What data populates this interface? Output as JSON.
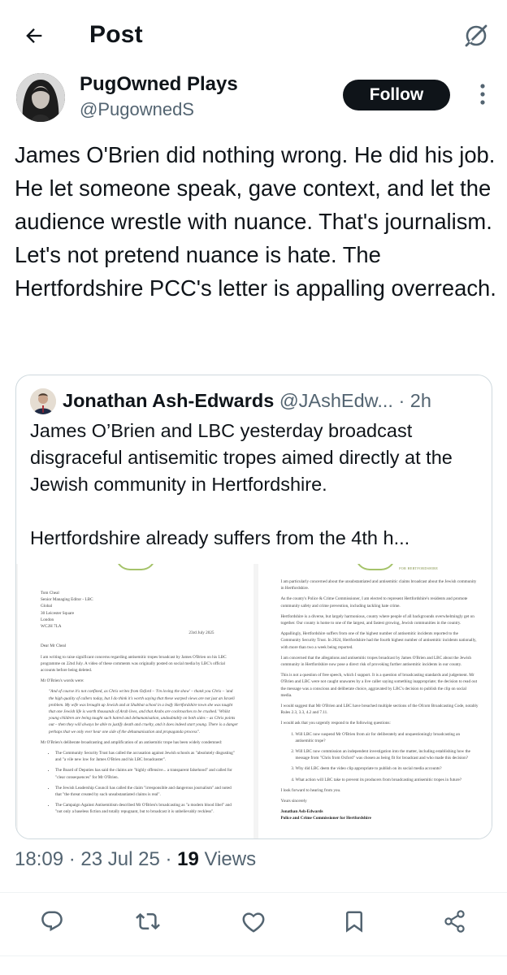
{
  "header": {
    "title": "Post"
  },
  "author": {
    "name": "PugOwned Plays",
    "handle": "@PugownedS",
    "follow_label": "Follow"
  },
  "post": {
    "text": "James O'Brien did nothing wrong. He did his job. He let someone speak, gave context, and let the audience wrestle with nuance. That's journalism. Let's not pretend nuance is hate. The Hertfordshire PCC's letter is appalling overreach."
  },
  "quote": {
    "name": "Jonathan Ash-Edwards",
    "handle": "@JAshEdw...",
    "time": "· 2h",
    "text_p1": "James O’Brien and LBC yesterday broadcast disgraceful antisemitic tropes aimed directly at the Jewish community in Hertfordshire.",
    "text_p2": "Hertfordshire already suffers from the 4th h..."
  },
  "letter_left": {
    "recipient": [
      "Tom Cheal",
      "Senior Managing Editor - LBC",
      "Global",
      "30 Leicester Square",
      "London",
      "WC2H 7LA"
    ],
    "date": "23rd July 2025",
    "salutation": "Dear Mr Cheal",
    "p1": "I am writing to raise significant concerns regarding antisemitic tropes broadcast by James O'Brien on his LBC programme on 22nd July. A video of these comments was originally posted on social media by LBC's official accounts before being deleted.",
    "p2": "Mr O'Brien's words were:",
    "quote": "\"And of course it's not confined, as Chris writes from Oxford – 'I'm loving the show' – thank you Chris – 'and the high quality of callers today, but I do think it's worth saying that these warped views are not just an Israeli problem. My wife was brought up Jewish and at Shabbat school in a leafy Hertfordshire town she was taught that one Jewish life is worth thousands of Arab lives, and that Arabs are cockroaches to be crushed.' Whilst young children are being taught such hatred and dehumanisation, undoubtably on both sides – as Chris points out – then they will always be able to justify death and cruelty, and it does indeed start young. There is a danger perhaps that we only ever hear one side of the dehumanisation and propaganda process\".",
    "p3": "Mr O'Brien's deliberate broadcasting and amplification of an antisemitic trope has been widely condemned:",
    "bullets": [
      "The Community Security Trust has called the accusation against Jewish schools as \"absolutely disgusting\" and \"a vile new low for James O'Brien and his LBC broadcaster\".",
      "The Board of Deputies has said the claims are \"highly offensive... a transparent falsehood\" and called for \"clear consequences\" for Mr O'Brien.",
      "The Jewish Leadership Council has called the claim \"irresponsible and dangerous journalism\" and noted that \"the threat created by such unsubstantiated claims is real\".",
      "The Campaign Against Antisemitism described Mr O'Brien's broadcasting as \"a modern blood libel\" and \"not only a baseless fiction and totally repugnant, but to broadcast it is unbelievably reckless\"."
    ]
  },
  "letter_right": {
    "logo_text": "FOR HERTFORDSHIRE",
    "p1": "I am particularly concerned about the unsubstantiated and antisemitic claims broadcast about the Jewish community in Hertfordshire.",
    "p2": "As the county's Police & Crime Commissioner, I am elected to represent Hertfordshire's residents and promote community safety and crime prevention, including tackling hate crime.",
    "p3": "Hertfordshire is a diverse, but largely harmonious, county where people of all backgrounds overwhelmingly get on together. Our county is home to one of the largest, and fastest growing, Jewish communities in the country.",
    "p4": "Appallingly, Hertfordshire suffers from one of the highest number of antisemitic incidents reported to the Community Security Trust. In 2024, Hertfordshire had the fourth highest number of antisemitic incidents nationally, with more than two a week being reported.",
    "p5": "I am concerned that the allegations and antisemitic tropes broadcast by James O'Brien and LBC about the Jewish community in Hertfordshire now pose a direct risk of provoking further antisemitic incidents in our county.",
    "p6": "This is not a question of free speech, which I support. It is a question of broadcasting standards and judgement. Mr O'Brien and LBC were not caught unawares by a live caller saying something inappropriate; the decision to read out the message was a conscious and deliberate choice, aggravated by LBC's decision to publish the clip on social media.",
    "p7": "I would suggest that Mr O'Brien and LBC have breached multiple sections of the Ofcom Broadcasting Code, notably Rules 2.3, 3.3, 4.2 and 7.11.",
    "p8": "I would ask that you urgently respond to the following questions:",
    "questions": [
      "Will LBC now suspend Mr O'Brien from air for deliberately and unquestioningly broadcasting an antisemitic trope?",
      "Will LBC now commission an independent investigation into the matter, including establishing how the message from \"Chris from Oxford\" was chosen as being fit for broadcast and who made this decision?",
      "Why did LBC deem the video clip appropriate to publish on its social media accounts?",
      "What action will LBC take to prevent its producers from broadcasting antisemitic tropes in future?"
    ],
    "closing1": "I look forward to hearing from you.",
    "closing2": "Yours sincerely",
    "sig_name": "Jonathan Ash-Edwards",
    "sig_title": "Police and Crime Commissioner for Hertfordshire"
  },
  "meta": {
    "time_date": "18:09 · 23 Jul 25 · ",
    "views_count": "19",
    "views_label": " Views"
  },
  "icons": {
    "back": "arrow-left-icon",
    "grok": "grok-icon",
    "more": "more-vertical-icon",
    "reply": "reply-icon",
    "repost": "repost-icon",
    "like": "heart-icon",
    "bookmark": "bookmark-icon",
    "share": "share-icon"
  },
  "colors": {
    "text": "#0f1419",
    "secondary": "#536471",
    "border": "#cfd9de",
    "button": "#0f1419"
  }
}
